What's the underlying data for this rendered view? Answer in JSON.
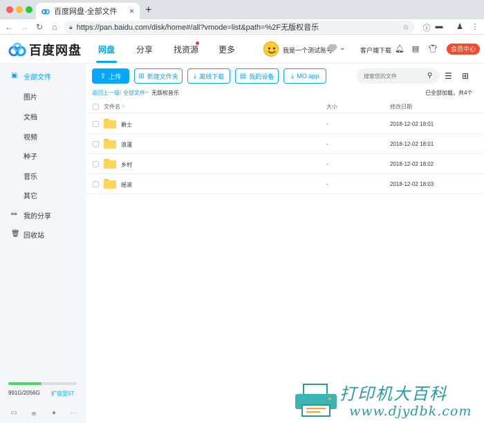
{
  "browser": {
    "tab_title": "百度网盘-全部文件",
    "tab_close": "×",
    "new_tab": "+",
    "url": "https://pan.baidu.com/disk/home#/all?vmode=list&path=%2F无版权音乐"
  },
  "header": {
    "logo_text": "百度网盘",
    "nav": [
      {
        "label": "网盘",
        "active": true
      },
      {
        "label": "分享",
        "active": false
      },
      {
        "label": "找资源",
        "active": false,
        "badge_dot": true
      },
      {
        "label": "更多",
        "active": false
      }
    ],
    "username": "我是一个测试账号",
    "client_download": "客户端下载",
    "member_center": "会员中心"
  },
  "sidebar": {
    "items": [
      {
        "label": "全部文件",
        "icon": "files-icon",
        "active": true
      },
      {
        "label": "图片",
        "sub": true
      },
      {
        "label": "文档",
        "sub": true
      },
      {
        "label": "视频",
        "sub": true
      },
      {
        "label": "种子",
        "sub": true
      },
      {
        "label": "音乐",
        "sub": true
      },
      {
        "label": "其它",
        "sub": true
      },
      {
        "label": "我的分享",
        "icon": "share-icon"
      },
      {
        "label": "回收站",
        "icon": "trash-icon"
      }
    ],
    "quota": {
      "text": "991G/2056G",
      "expand": "扩容至5T",
      "used_fraction": 0.48
    }
  },
  "toolbar": {
    "upload": "上传",
    "new_folder": "新建文件夹",
    "offline_download": "离线下载",
    "my_devices": "我的设备",
    "mo_app": "MO.app",
    "search_placeholder": "搜索您的文件"
  },
  "breadcrumb": {
    "back": "返回上一级",
    "sep": "|",
    "root": "全部文件",
    "arrow": ">",
    "current": "无版权音乐",
    "loaded": "已全部加载，共4个"
  },
  "table": {
    "headers": {
      "name": "文件名",
      "size": "大小",
      "modified": "修改日期"
    },
    "sort_arrow": "↑",
    "rows": [
      {
        "name": "爵士",
        "size": "-",
        "modified": "2018-12-02 18:01"
      },
      {
        "name": "浪漫",
        "size": "-",
        "modified": "2018-12-02 18:01"
      },
      {
        "name": "乡村",
        "size": "-",
        "modified": "2018-12-02 18:02"
      },
      {
        "name": "摇滚",
        "size": "-",
        "modified": "2018-12-02 18:03"
      }
    ]
  },
  "watermark": {
    "title": "打印机大百科",
    "url": "www.djydbk.com"
  },
  "colors": {
    "accent": "#06a7ff",
    "member": "#f24b2e",
    "folder": "#ffd55a",
    "quota": "#4cd964"
  }
}
